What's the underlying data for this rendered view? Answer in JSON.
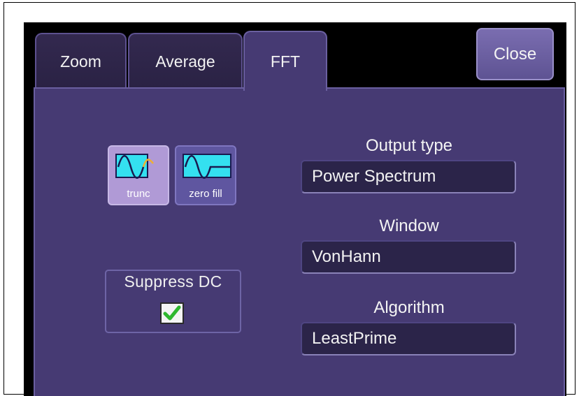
{
  "tabs": [
    {
      "label": "Zoom",
      "active": false
    },
    {
      "label": "Average",
      "active": false
    },
    {
      "label": "FFT",
      "active": true
    }
  ],
  "close_label": "Close",
  "modes": {
    "trunc": {
      "label": "trunc",
      "selected": true,
      "icon": "truncated-sine-icon"
    },
    "zero_fill": {
      "label": "zero fill",
      "selected": false,
      "icon": "zero-fill-sine-icon"
    }
  },
  "suppress_dc": {
    "label": "Suppress DC",
    "checked": true
  },
  "output_type": {
    "label": "Output type",
    "value": "Power Spectrum"
  },
  "window": {
    "label": "Window",
    "value": "VonHann"
  },
  "algorithm": {
    "label": "Algorithm",
    "value": "LeastPrime"
  },
  "colors": {
    "panel": "#463a73",
    "tab_inactive": "#2f2649",
    "selected_mode": "#b09ad6",
    "wave_fill": "#34e0f0",
    "check": "#2eb82e"
  }
}
